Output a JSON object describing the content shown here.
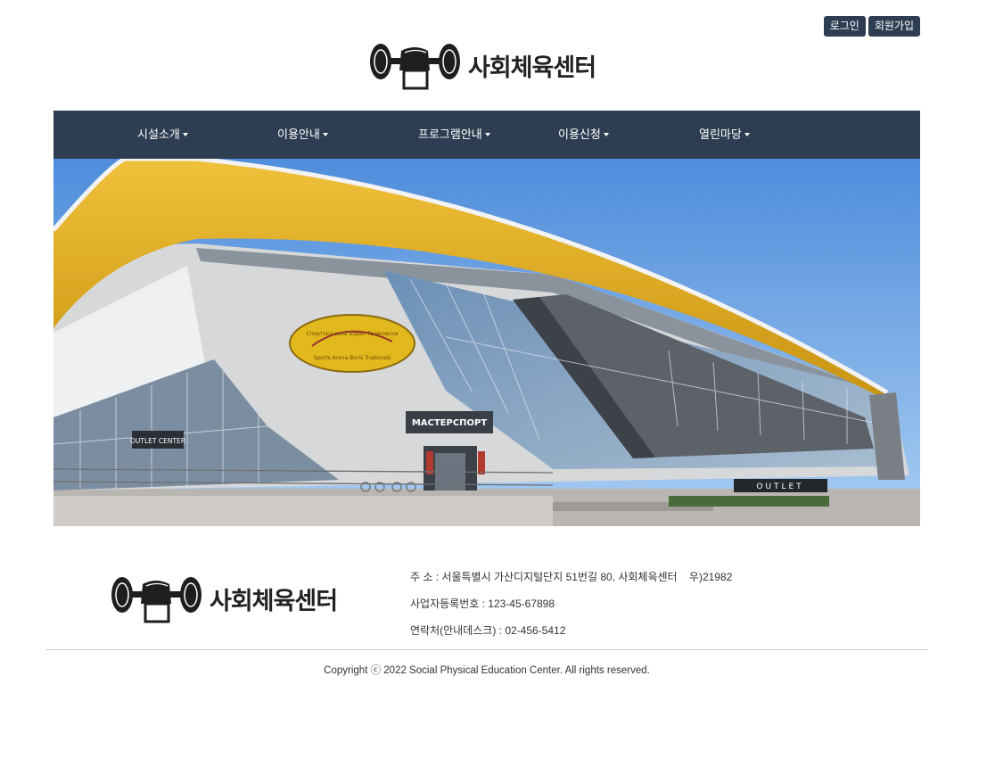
{
  "auth": {
    "login": "로그인",
    "signup": "회원가입"
  },
  "brand": {
    "name": "사회체육센터"
  },
  "nav": {
    "items": [
      {
        "label": "시설소개"
      },
      {
        "label": "이용안내"
      },
      {
        "label": "프로그램안내"
      },
      {
        "label": "이용신청"
      },
      {
        "label": "열린마당"
      }
    ]
  },
  "hero": {
    "sign_oval_1": "Спортска сала Борис Трајковски",
    "sign_oval_2": "Sports Arena Boris Trajkovski",
    "sign_store": "МАСТЕРСПОРТ",
    "sign_outlet": "OUTLET",
    "sign_outlet_center": "OUTLET CENTER"
  },
  "footer": {
    "address": "주 소 : 서울특별시 가산디지털단지 51번길 80, 사회체육센터    우)21982",
    "business_no": "사업자등록번호 : 123-45-67898",
    "contact": "연락처(안내데스크) : 02-456-5412",
    "copyright": "Copyright ⓒ 2022 Social Physical Education Center. All rights reserved."
  },
  "colors": {
    "nav_bg": "#2e3e52",
    "roof": "#e0ad1d",
    "sky": "#5f9ae0"
  }
}
